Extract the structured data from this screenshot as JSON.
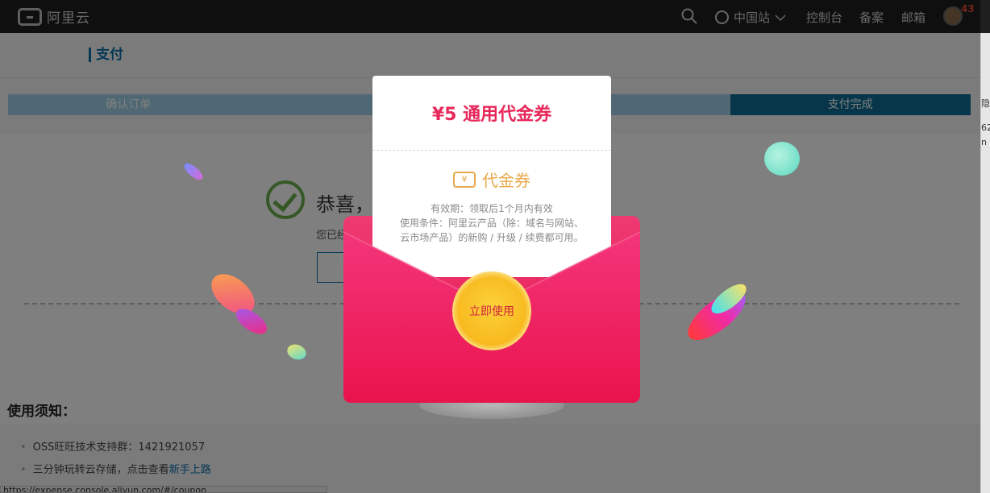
{
  "topbar": {
    "logo_text": "阿里云",
    "region_label": "中国站",
    "links": [
      "控制台",
      "备案",
      "邮箱"
    ],
    "badge_count": "43"
  },
  "page": {
    "title": "支付",
    "steps": [
      {
        "label": "确认订单",
        "state": "past"
      },
      {
        "label": "",
        "state": "past"
      },
      {
        "label": "",
        "state": "past"
      },
      {
        "label": "支付完成",
        "state": "current"
      }
    ],
    "congrats_text": "恭喜，",
    "sub_message": "您已经",
    "notice_title": "使用须知：",
    "notice_items": [
      {
        "text": "OSS旺旺技术支持群：1421921057",
        "link": ""
      },
      {
        "text": "三分钟玩转云存储，点击查看",
        "link": "新手上路"
      }
    ],
    "side_hints": [
      "隐",
      "62",
      "n"
    ]
  },
  "statusbar": {
    "url": "https://expense.console.aliyun.com/#/coupon"
  },
  "modal": {
    "amount_title": "¥5 通用代金券",
    "coupon_label": "代金券",
    "ticket_glyph": "¥",
    "validity": "有效期：领取后1个月内有效",
    "conditions": "使用条件：阿里云产品（除：域名与网站、云市场产品）的新购 / 升级 / 续费都可用。",
    "use_button": "立即使用"
  },
  "colors": {
    "envelope_red": "#e9134d",
    "amount_red": "#e8275a",
    "coupon_gold": "#e8a94a",
    "step_active": "#0e6d94",
    "topbar_bg": "#1f1f1f"
  }
}
